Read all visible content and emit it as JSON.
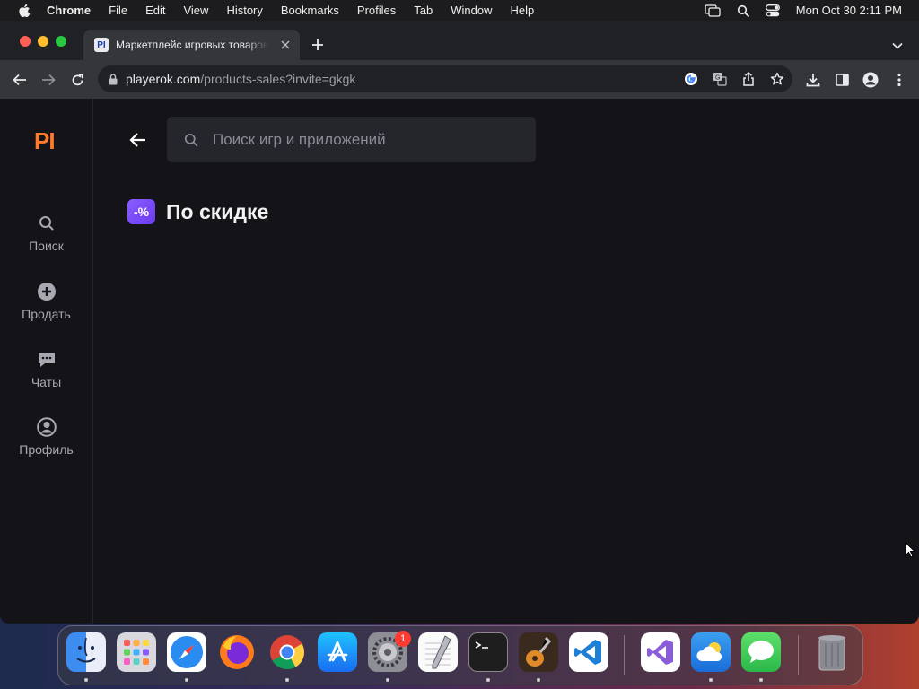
{
  "menubar": {
    "app": "Chrome",
    "items": [
      "File",
      "Edit",
      "View",
      "History",
      "Bookmarks",
      "Profiles",
      "Tab",
      "Window",
      "Help"
    ],
    "clock": "Mon Oct 30  2:11 PM"
  },
  "browser": {
    "tab": {
      "favicon_text": "PI",
      "title": "Маркетплейс игровых товаров"
    },
    "address": {
      "host": "playerok.com",
      "path": "/products-sales?invite=gkgk"
    }
  },
  "site": {
    "logo": "PI",
    "logo_color": "#ff7a2a",
    "nav": [
      {
        "label": "Поиск",
        "icon": "search-icon"
      },
      {
        "label": "Продать",
        "icon": "plus-circle-icon"
      },
      {
        "label": "Чаты",
        "icon": "chat-icon"
      },
      {
        "label": "Профиль",
        "icon": "profile-icon"
      }
    ],
    "search": {
      "placeholder": "Поиск игр и приложений",
      "value": ""
    },
    "section": {
      "badge": "-%",
      "title": "По скидке",
      "badge_color": "#7b4cff"
    }
  },
  "dock": {
    "apps": [
      "Finder",
      "Launchpad",
      "Safari",
      "Firefox",
      "Chrome",
      "App Store",
      "System Settings",
      "TextEdit",
      "Terminal",
      "GarageBand",
      "Visual Studio Code",
      "Visual Studio",
      "Weather",
      "Messages",
      "Trash"
    ],
    "notification_badge": "1"
  }
}
